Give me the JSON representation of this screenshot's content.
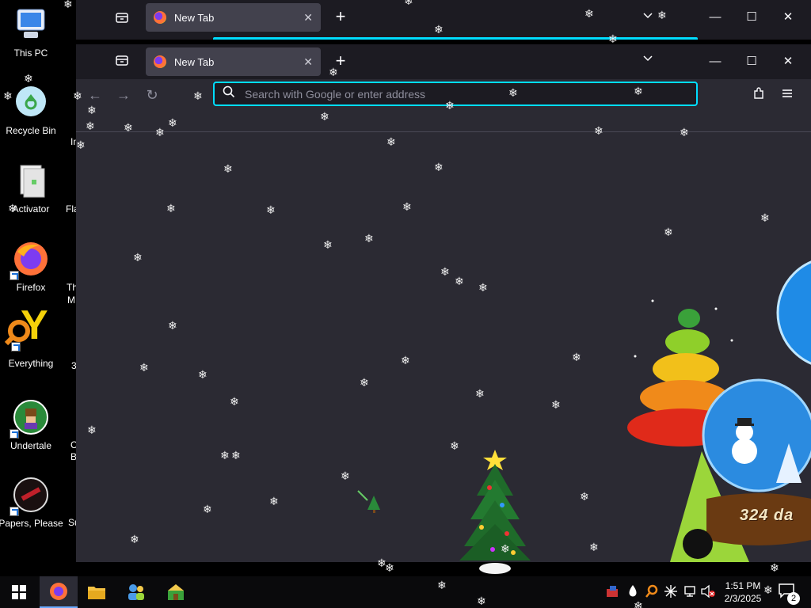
{
  "desktop": {
    "icons": [
      {
        "label": "This PC"
      },
      {
        "label": "Recycle Bin"
      },
      {
        "label": "Activator"
      },
      {
        "label": "Firefox"
      },
      {
        "label": "Everything"
      },
      {
        "label": "Undertale"
      },
      {
        "label": "Papers, Please"
      }
    ],
    "partial_labels": [
      "In",
      "Fla",
      "Th",
      "M",
      "3",
      "C",
      "B",
      "Su"
    ]
  },
  "browser_back": {
    "tab_title": "New Tab",
    "close_glyph": "✕",
    "newtab_glyph": "+"
  },
  "browser": {
    "tab_title": "New Tab",
    "close_glyph": "✕",
    "newtab_glyph": "+",
    "minimize_glyph": "—",
    "maximize_glyph": "☐",
    "close_window_glyph": "✕",
    "list_tabs_glyph": "⌄",
    "back_glyph": "←",
    "forward_glyph": "→",
    "reload_glyph": "↻",
    "search_placeholder": "Search with Google or enter address",
    "search_value": "",
    "extensions_glyph": "⧉",
    "menu_glyph": "≡"
  },
  "decorations": {
    "countdown_text": "324 da"
  },
  "taskbar": {
    "start_icon": "windows-logo-icon",
    "pinned": [
      "firefox-icon",
      "file-explorer-icon",
      "people-icon",
      "game-icon"
    ],
    "tray_icons": [
      "tray-app-icon",
      "water-drop-icon",
      "search-tool-icon",
      "snowflake-icon",
      "network-icon",
      "volume-muted-icon"
    ],
    "time": "1:51 PM",
    "date": "2/3/2025",
    "notification_count": "2"
  },
  "colors": {
    "firefox_dark_bg": "#2b2a33",
    "tab_strip": "#1c1b22",
    "url_focus_ring": "#00ddff"
  }
}
